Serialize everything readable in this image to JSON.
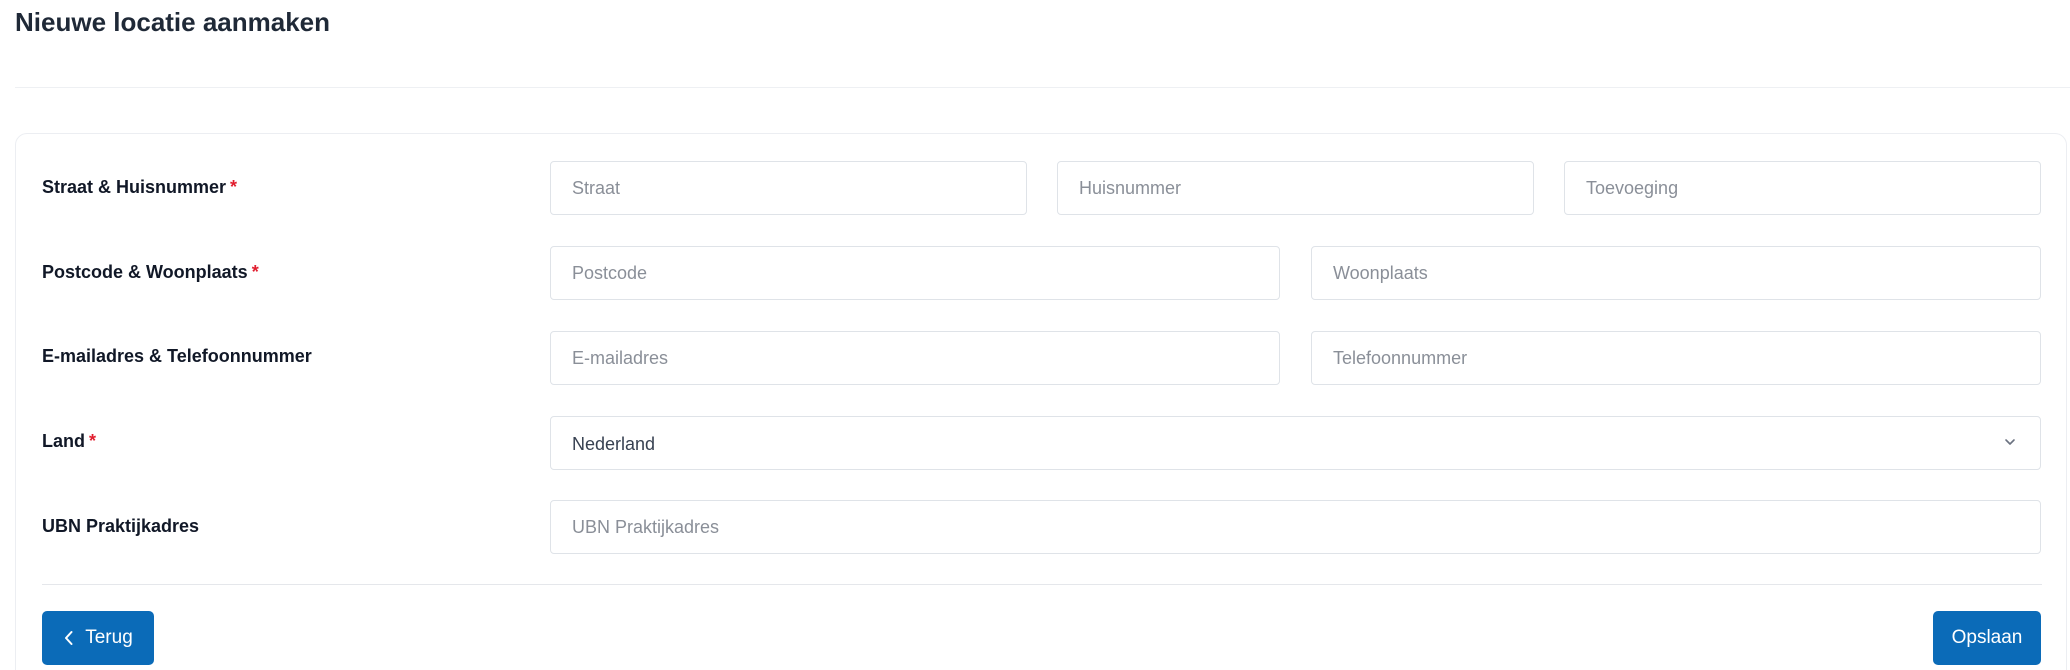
{
  "page": {
    "title": "Nieuwe locatie aanmaken"
  },
  "form": {
    "required_mark": "*",
    "street_row": {
      "label": "Straat & Huisnummer",
      "street_placeholder": "Straat",
      "number_placeholder": "Huisnummer",
      "addition_placeholder": "Toevoeging"
    },
    "postal_row": {
      "label": "Postcode & Woonplaats",
      "postcode_placeholder": "Postcode",
      "city_placeholder": "Woonplaats"
    },
    "contact_row": {
      "label": "E-mailadres & Telefoonnummer",
      "email_placeholder": "E-mailadres",
      "phone_placeholder": "Telefoonnummer"
    },
    "country_row": {
      "label": "Land",
      "selected": "Nederland"
    },
    "ubn_row": {
      "label": "UBN Praktijkadres",
      "placeholder": "UBN Praktijkadres"
    }
  },
  "actions": {
    "back_label": "Terug",
    "save_label": "Opslaan"
  },
  "colors": {
    "primary": "#0b6bb8",
    "required": "#e11d2e"
  },
  "icons": {
    "back": "chevron-left-icon",
    "select": "chevron-down-icon"
  }
}
